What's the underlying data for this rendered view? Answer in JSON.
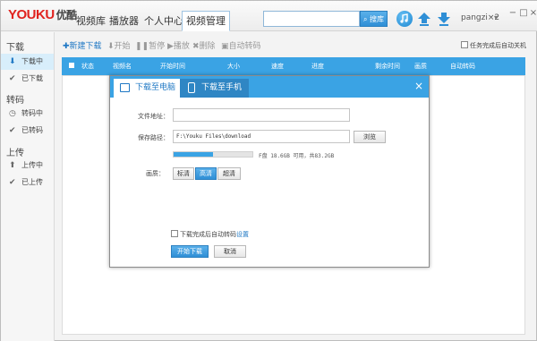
{
  "app": {
    "logo_main": "YOUKU",
    "logo_cn": "优酷"
  },
  "nav": {
    "tabs": [
      {
        "label": "视频库"
      },
      {
        "label": "播放器"
      },
      {
        "label": "个人中心"
      },
      {
        "label": "视频管理"
      }
    ]
  },
  "search": {
    "value": "",
    "button_label": "搜库"
  },
  "toolbar_icons": [
    "music-icon",
    "upload-icon",
    "download-icon"
  ],
  "user": {
    "name": "pangzi×2",
    "caret": "▾"
  },
  "window_controls": {
    "minimize": "−",
    "maximize": "□",
    "close": "×"
  },
  "sidebar": {
    "groups": [
      {
        "title": "下载",
        "items": [
          {
            "label": "下载中",
            "icon": "download-arrow-icon",
            "active": true
          },
          {
            "label": "已下载",
            "icon": "check-icon",
            "active": false
          }
        ]
      },
      {
        "title": "转码",
        "items": [
          {
            "label": "转码中",
            "icon": "clock-icon",
            "active": false
          },
          {
            "label": "已转码",
            "icon": "check-icon",
            "active": false
          }
        ]
      },
      {
        "title": "上传",
        "items": [
          {
            "label": "上传中",
            "icon": "upload-arrow-icon",
            "active": false
          },
          {
            "label": "已上传",
            "icon": "check-icon",
            "active": false
          }
        ]
      }
    ]
  },
  "actions": {
    "new_download": "新建下载",
    "start": "开始",
    "pause": "暂停",
    "play": "播放",
    "delete": "删除",
    "auto_transcode": "自动转码"
  },
  "auto_shutdown_label": "任务完成后自动关机",
  "table": {
    "columns": [
      "状态",
      "视频名",
      "开始时间",
      "大小",
      "速度",
      "进度",
      "剩余时间",
      "画质",
      "自动转码"
    ]
  },
  "dialog": {
    "tab_pc": "下载至电脑",
    "tab_phone": "下载至手机",
    "close": "×",
    "url_label": "文件地址：",
    "url_value": "",
    "path_label": "保存路径：",
    "path_value": "F:\\Youku Files\\download",
    "browse_label": "浏览",
    "disk_space": "F盘 18.6GB 可用，共83.2GB",
    "disk_used_fraction": 0.5,
    "quality_label": "画质：",
    "quality_options": [
      {
        "label": "标清",
        "selected": false
      },
      {
        "label": "高清",
        "selected": true
      },
      {
        "label": "超清",
        "selected": false
      }
    ],
    "auto_transcode_label": "下载完成后自动转码",
    "settings_link": "设置",
    "start_button": "开始下载",
    "cancel_button": "取消"
  }
}
